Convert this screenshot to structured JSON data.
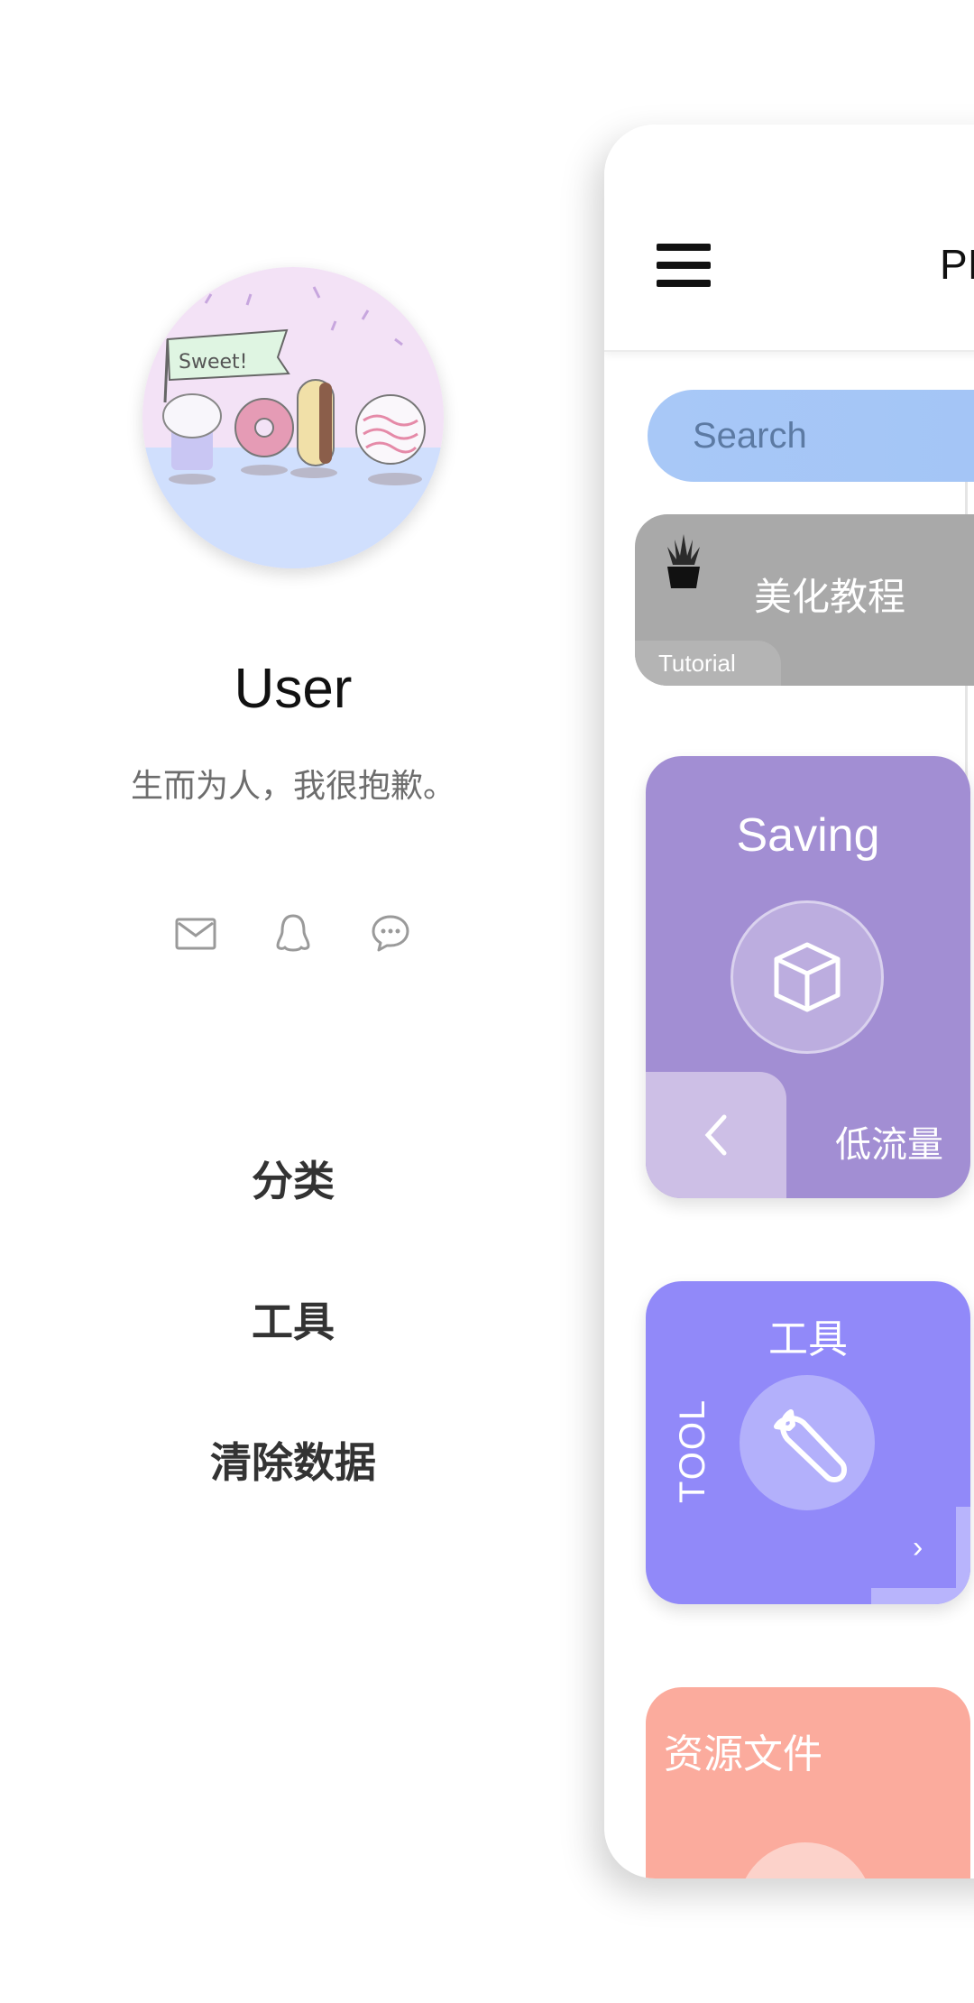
{
  "drawer": {
    "username": "User",
    "motto": "生而为人，我很抱歉。",
    "contacts": [
      {
        "icon": "mail-icon"
      },
      {
        "icon": "qq-icon"
      },
      {
        "icon": "chat-icon"
      }
    ],
    "menu": [
      "分类",
      "工具",
      "清除数据"
    ]
  },
  "panel": {
    "title": "PI",
    "search": {
      "placeholder": "Search"
    },
    "tutorial": {
      "title": "美化教程",
      "tag": "Tutorial"
    },
    "saving": {
      "title": "Saving",
      "subtitle": "低流量"
    },
    "tool": {
      "title": "工具",
      "vertical_label": "TOOL"
    },
    "resource": {
      "title": "资源文件"
    }
  },
  "colors": {
    "search_bg": "#a8c8f7",
    "tutorial_bg": "#a9a9a9",
    "saving_bg": "#a28ed3",
    "tool_bg": "#9189f9",
    "resource_bg": "#fbab9d"
  }
}
